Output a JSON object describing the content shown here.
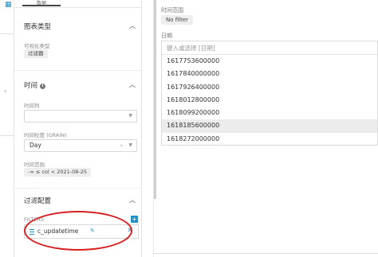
{
  "panel": {
    "tab_label": "数据",
    "chart_type_section": {
      "title": "图表类型",
      "visualization_label": "可视化类型",
      "visualization_value": "过滤器"
    },
    "time_section": {
      "title": "时间",
      "time_column_label": "时间列",
      "grain_label": "时间粒度 (GRAIN)",
      "grain_value": "Day",
      "range_label": "时间范围",
      "range_value": "-∞ ≤ col < 2021-08-25"
    },
    "filter_section": {
      "title": "过滤配置",
      "filters_label": "FILTERS",
      "filter_item": "c_updatetime"
    }
  },
  "popover": {
    "time_range_label": "时间范围",
    "no_filter": "No filter",
    "date_label": "日期",
    "search_placeholder": "键入或选择 [日期]",
    "options": [
      "1617753600000",
      "1617840000000",
      "1617926400000",
      "1618012800000",
      "1618099200000",
      "1618185600000",
      "1618272000000"
    ],
    "highlighted_index": 5
  },
  "icons": {
    "caret_up": "chevron-up-icon",
    "info": "info-icon",
    "caret_down": "chevron-down-icon",
    "clear": "clear-icon",
    "add": "plus-icon",
    "drag": "drag-handle-icon",
    "edit": "edit-icon",
    "remove": "close-icon"
  },
  "colors": {
    "accent": "#1f8fc4",
    "annotation": "#d61f1f",
    "highlight_row": "#ececec"
  }
}
